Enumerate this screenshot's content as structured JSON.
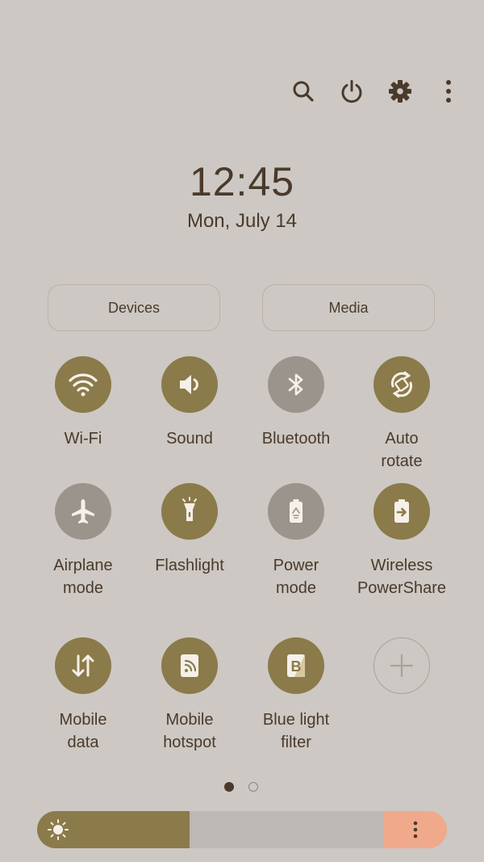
{
  "header": {
    "icons": [
      "search-icon",
      "power-icon",
      "settings-icon",
      "more-icon"
    ]
  },
  "clock": {
    "time": "12:45",
    "date": "Mon, July 14"
  },
  "pills": {
    "devices": "Devices",
    "media": "Media"
  },
  "tiles": [
    {
      "label": "Wi-Fi",
      "state": "on",
      "icon": "wifi-icon"
    },
    {
      "label": "Sound",
      "state": "on",
      "icon": "sound-icon"
    },
    {
      "label": "Bluetooth",
      "state": "off",
      "icon": "bluetooth-icon"
    },
    {
      "label": "Auto\nrotate",
      "state": "on",
      "icon": "auto-rotate-icon"
    },
    {
      "label": "Airplane\nmode",
      "state": "off",
      "icon": "airplane-icon"
    },
    {
      "label": "Flashlight",
      "state": "on",
      "icon": "flashlight-icon"
    },
    {
      "label": "Power\nmode",
      "state": "off",
      "icon": "power-mode-icon"
    },
    {
      "label": "Wireless\nPowerShare",
      "state": "on",
      "icon": "wireless-powershare-icon"
    },
    {
      "label": "Mobile\ndata",
      "state": "on",
      "icon": "mobile-data-icon"
    },
    {
      "label": "Mobile\nhotspot",
      "state": "on",
      "icon": "mobile-hotspot-icon"
    },
    {
      "label": "Blue light\nfilter",
      "state": "on",
      "icon": "blue-light-filter-icon"
    }
  ],
  "pager": {
    "current_page": 1,
    "total_pages": 2
  },
  "brightness": {
    "level": 0.44
  },
  "colors": {
    "accent": "#8b7a4a",
    "inactive": "#9a948d",
    "background": "#cdc8c3",
    "brightness_menu": "#f0a98a",
    "text": "#4a3a2c"
  }
}
